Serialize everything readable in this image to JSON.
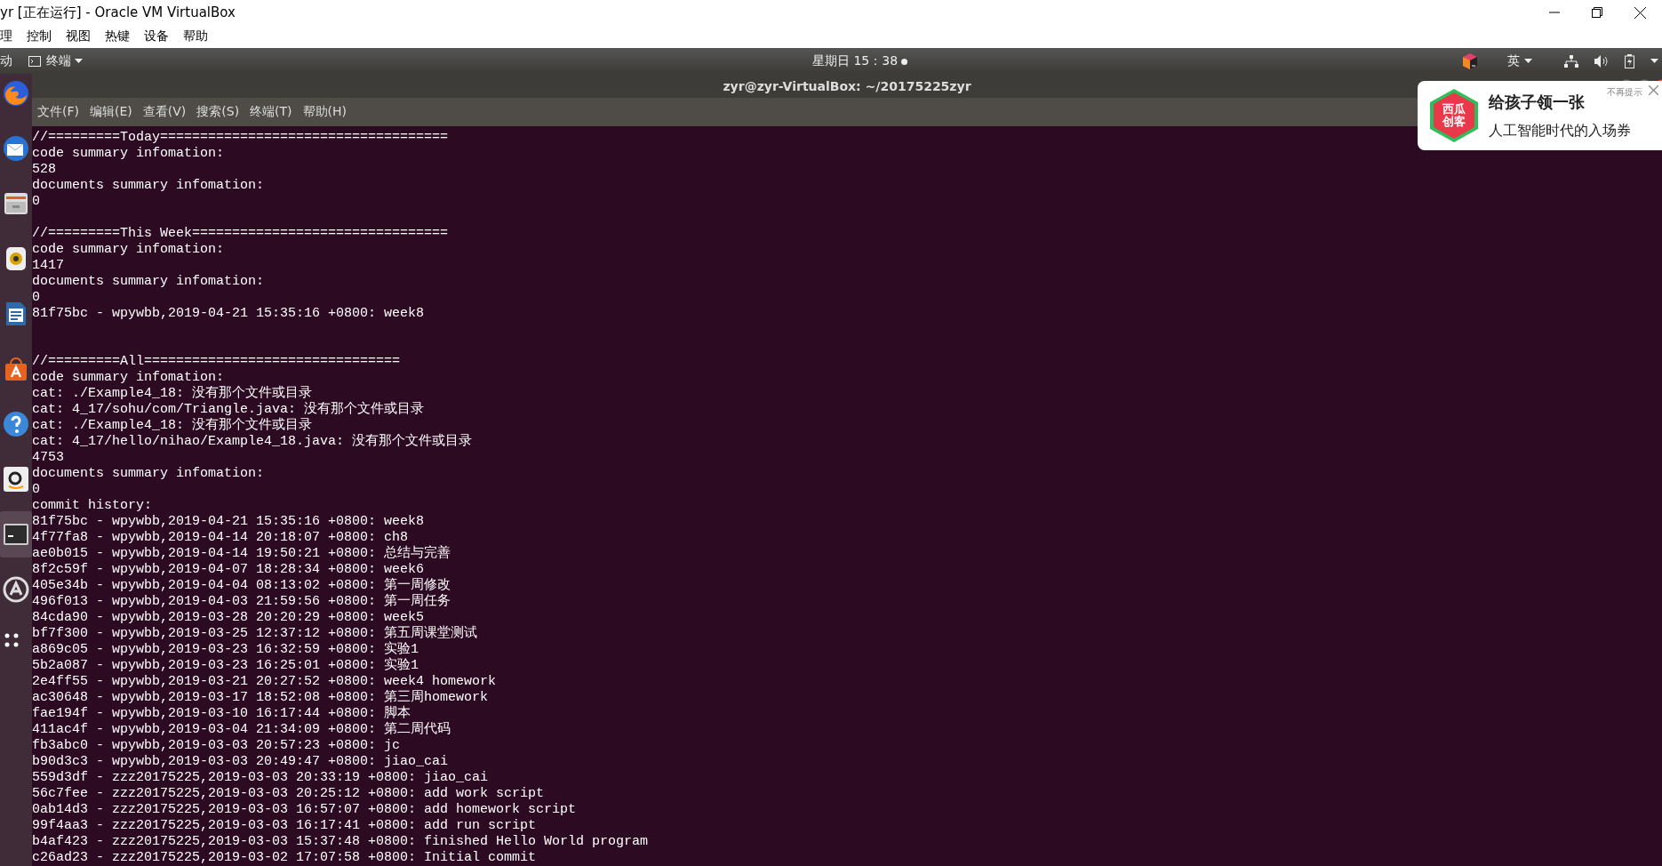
{
  "window": {
    "title": "yr [正在运行] - Oracle VM VirtualBox"
  },
  "vm_menu": [
    "理",
    "控制",
    "视图",
    "热键",
    "设备",
    "帮助"
  ],
  "top_panel": {
    "activities": "动",
    "app_menu": "终端",
    "clock": "星期日 15：38",
    "input_method": "英"
  },
  "dock": [
    {
      "kind": "firefox",
      "selected": false
    },
    {
      "kind": "mail",
      "selected": false
    },
    {
      "kind": "files",
      "selected": false
    },
    {
      "kind": "speaker",
      "selected": false
    },
    {
      "kind": "document",
      "selected": false
    },
    {
      "kind": "bag",
      "selected": false
    },
    {
      "kind": "help",
      "selected": false
    },
    {
      "kind": "amazon",
      "selected": false
    },
    {
      "kind": "terminal",
      "selected": true
    },
    {
      "kind": "update",
      "selected": false
    },
    {
      "kind": "grid",
      "selected": false
    }
  ],
  "terminal": {
    "title": "zyr@zyr-VirtualBox: ~/20175225zyr",
    "menu": [
      "文件(F)",
      "编辑(E)",
      "查看(V)",
      "搜索(S)",
      "终端(T)",
      "帮助(H)"
    ],
    "lines": [
      {
        "kind": "text",
        "text": "//=========Today===================================="
      },
      {
        "kind": "text",
        "text": "code summary infomation:"
      },
      {
        "kind": "text",
        "text": "528"
      },
      {
        "kind": "text",
        "text": "documents summary infomation:"
      },
      {
        "kind": "text",
        "text": "0"
      },
      {
        "kind": "blank"
      },
      {
        "kind": "text",
        "text": "//=========This Week================================"
      },
      {
        "kind": "text",
        "text": "code summary infomation:"
      },
      {
        "kind": "text",
        "text": "1417"
      },
      {
        "kind": "text",
        "text": "documents summary infomation:"
      },
      {
        "kind": "text",
        "text": "0"
      },
      {
        "kind": "text",
        "text": "81f75bc - wpywbb,2019-04-21 15:35:16 +0800: week8"
      },
      {
        "kind": "blank"
      },
      {
        "kind": "blank"
      },
      {
        "kind": "text",
        "text": "//=========All================================"
      },
      {
        "kind": "text",
        "text": "code summary infomation:"
      },
      {
        "kind": "text",
        "text": "cat: ./Example4_18: 没有那个文件或目录"
      },
      {
        "kind": "text",
        "text": "cat: 4_17/sohu/com/Triangle.java: 没有那个文件或目录"
      },
      {
        "kind": "text",
        "text": "cat: ./Example4_18: 没有那个文件或目录"
      },
      {
        "kind": "text",
        "text": "cat: 4_17/hello/nihao/Example4_18.java: 没有那个文件或目录"
      },
      {
        "kind": "text",
        "text": "4753"
      },
      {
        "kind": "text",
        "text": "documents summary infomation:"
      },
      {
        "kind": "text",
        "text": "0"
      },
      {
        "kind": "text",
        "text": "commit history:"
      },
      {
        "kind": "text",
        "text": "81f75bc - wpywbb,2019-04-21 15:35:16 +0800: week8"
      },
      {
        "kind": "text",
        "text": "4f77fa8 - wpywbb,2019-04-14 20:18:07 +0800: ch8"
      },
      {
        "kind": "text",
        "text": "ae0b015 - wpywbb,2019-04-14 19:50:21 +0800: 总结与完善"
      },
      {
        "kind": "text",
        "text": "8f2c59f - wpywbb,2019-04-07 18:28:34 +0800: week6"
      },
      {
        "kind": "text",
        "text": "405e34b - wpywbb,2019-04-04 08:13:02 +0800: 第一周修改"
      },
      {
        "kind": "text",
        "text": "496f013 - wpywbb,2019-04-03 21:59:56 +0800: 第一周任务"
      },
      {
        "kind": "text",
        "text": "84cda90 - wpywbb,2019-03-28 20:20:29 +0800: week5"
      },
      {
        "kind": "text",
        "text": "bf7f300 - wpywbb,2019-03-25 12:37:12 +0800: 第五周课堂测试"
      },
      {
        "kind": "text",
        "text": "a869c05 - wpywbb,2019-03-23 16:32:59 +0800: 实验1"
      },
      {
        "kind": "text",
        "text": "5b2a087 - wpywbb,2019-03-23 16:25:01 +0800: 实验1"
      },
      {
        "kind": "text",
        "text": "2e4ff55 - wpywbb,2019-03-21 20:27:52 +0800: week4 homework"
      },
      {
        "kind": "text",
        "text": "ac30648 - wpywbb,2019-03-17 18:52:08 +0800: 第三周homework"
      },
      {
        "kind": "text",
        "text": "fae194f - wpywbb,2019-03-10 16:17:44 +0800: 脚本"
      },
      {
        "kind": "text",
        "text": "411ac4f - wpywbb,2019-03-04 21:34:09 +0800: 第二周代码"
      },
      {
        "kind": "text",
        "text": "fb3abc0 - wpywbb,2019-03-03 20:57:23 +0800: jc"
      },
      {
        "kind": "text",
        "text": "b90d3c3 - wpywbb,2019-03-03 20:49:47 +0800: jiao_cai"
      },
      {
        "kind": "text",
        "text": "559d3df - zzz20175225,2019-03-03 20:33:19 +0800: jiao_cai"
      },
      {
        "kind": "text",
        "text": "56c7fee - zzz20175225,2019-03-03 20:25:12 +0800: add work script"
      },
      {
        "kind": "text",
        "text": "0ab14d3 - zzz20175225,2019-03-03 16:57:07 +0800: add homework script"
      },
      {
        "kind": "text",
        "text": "99f4aa3 - zzz20175225,2019-03-03 16:17:41 +0800: add run script"
      },
      {
        "kind": "text",
        "text": "b4af423 - zzz20175225,2019-03-03 15:37:48 +0800: finished Hello World program"
      },
      {
        "kind": "text",
        "text": "c26ad23 - zzz20175225,2019-03-02 17:07:58 +0800: Initial commit"
      }
    ]
  },
  "ad_popup": {
    "logo_top": "西瓜",
    "logo_bottom": "创客",
    "headline": "给孩子领一张",
    "dismiss": "不再提示",
    "subline": "人工智能时代的入场券"
  }
}
